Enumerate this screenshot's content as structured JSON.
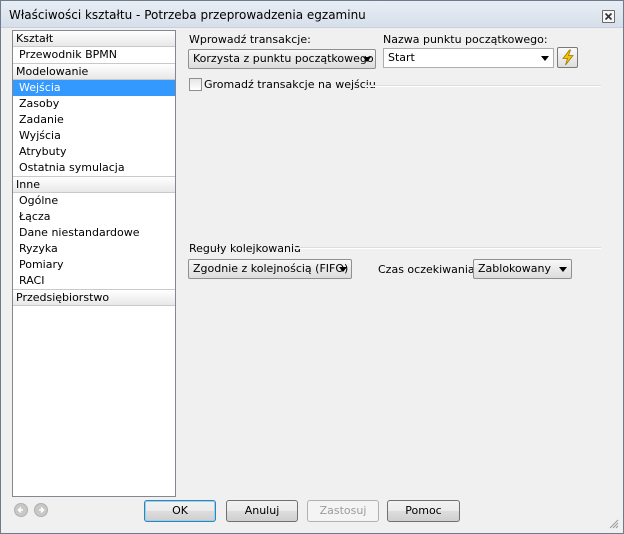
{
  "window": {
    "title": "Właściwości kształtu - Potrzeba  przeprowadzenia  egzaminu"
  },
  "sidebar": {
    "groups": [
      {
        "label": "Kształt",
        "items": [
          "Przewodnik BPMN"
        ]
      },
      {
        "label": "Modelowanie",
        "items": [
          "Wejścia",
          "Zasoby",
          "Zadanie",
          "Wyjścia",
          "Atrybuty",
          "Ostatnia symulacja"
        ]
      },
      {
        "label": "Inne",
        "items": [
          "Ogólne",
          "Łącza",
          "Dane niestandardowe",
          "Ryzyka",
          "Pomiary",
          "RACI"
        ]
      },
      {
        "label": "Przedsiębiorstwo",
        "items": []
      }
    ],
    "selected": "Wejścia"
  },
  "inputs": {
    "transaction_label": "Wprowadź transakcje:",
    "transaction_value": "Korzysta z punktu początkowego",
    "start_point_label": "Nazwa punktu początkowego:",
    "start_point_value": "Start",
    "accumulate_label": "Gromadź transakcje na wejściu",
    "accumulate_checked": false
  },
  "queue": {
    "section_label": "Reguły kolejkowania",
    "rule_value": "Zgodnie z kolejnością (FIFO)",
    "wait_label": "Czas oczekiwania:",
    "wait_value": "Zablokowany"
  },
  "buttons": {
    "ok": "OK",
    "cancel": "Anuluj",
    "apply": "Zastosuj",
    "help": "Pomoc"
  },
  "icons": {
    "close": "close-icon",
    "bolt": "lightning-icon",
    "back": "back-arrow-icon",
    "forward": "forward-arrow-icon"
  },
  "colors": {
    "selection": "#3399ff",
    "bolt": "#f5c400"
  }
}
